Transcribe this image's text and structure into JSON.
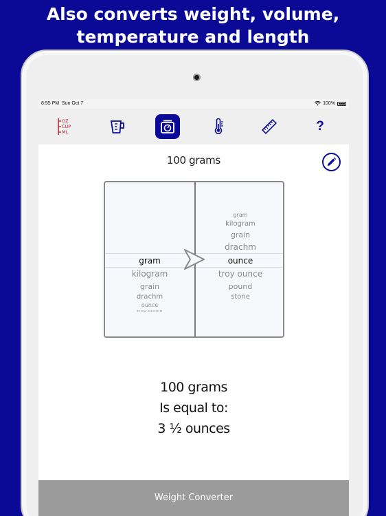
{
  "headline": {
    "line1": "Also converts weight, volume,",
    "line2": "temperature and length"
  },
  "status_bar": {
    "time": "8:55 PM",
    "date": "Sun Oct 7",
    "battery": "100%"
  },
  "toolbar": {
    "units_icon": {
      "name": "measure-units-icon",
      "labels": [
        "OZ",
        "CUP",
        "ML"
      ],
      "color": "#b0202a"
    },
    "volume_icon": "measuring-cup-icon",
    "weight_icon": "kitchen-scale-icon",
    "temperature_icon": "thermometer-icon",
    "length_icon": "ruler-icon",
    "help_label": "?"
  },
  "main": {
    "amount_title": "100 grams",
    "edit_icon": "pencil-icon",
    "from_units": [
      "gram",
      "kilogram",
      "grain",
      "drachm",
      "ounce",
      "troy ounce"
    ],
    "from_selected": "gram",
    "to_units": [
      "gram",
      "kilogram",
      "grain",
      "drachm",
      "ounce",
      "troy ounce",
      "pound",
      "stone"
    ],
    "to_selected": "ounce",
    "arrow_icon": "convert-arrow-icon",
    "result": {
      "line1": "100 grams",
      "line2": "Is equal to:",
      "line3": "3 ½ ounces"
    }
  },
  "bottom_bar": {
    "label": "Weight Converter"
  },
  "colors": {
    "accent": "#0a0a96",
    "background": "#0a0a96",
    "bottom_bar": "#9b9b9b"
  }
}
